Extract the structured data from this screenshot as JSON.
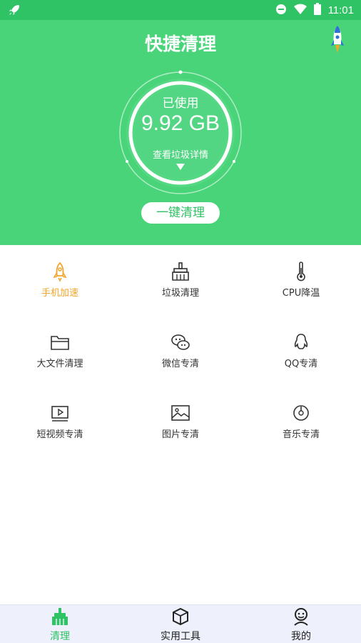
{
  "status_bar": {
    "time": "11:01",
    "icons": [
      "rocket-notification-icon",
      "do-not-disturb-icon",
      "wifi-icon",
      "battery-icon"
    ]
  },
  "header": {
    "title": "快捷清理",
    "rocket_icon": "rocket-icon"
  },
  "storage": {
    "used_label": "已使用",
    "used_value": "9.92 GB",
    "detail_link": "查看垃圾详情"
  },
  "actions": {
    "clean_button": "一键清理"
  },
  "tools": [
    {
      "label": "手机加速",
      "icon": "rocket-icon",
      "active": true
    },
    {
      "label": "垃圾清理",
      "icon": "broom-icon",
      "active": false
    },
    {
      "label": "CPU降温",
      "icon": "thermometer-icon",
      "active": false
    },
    {
      "label": "大文件清理",
      "icon": "folder-icon",
      "active": false
    },
    {
      "label": "微信专清",
      "icon": "wechat-icon",
      "active": false
    },
    {
      "label": "QQ专清",
      "icon": "qq-icon",
      "active": false
    },
    {
      "label": "短视频专清",
      "icon": "video-icon",
      "active": false
    },
    {
      "label": "图片专清",
      "icon": "image-icon",
      "active": false
    },
    {
      "label": "音乐专清",
      "icon": "music-disc-icon",
      "active": false
    }
  ],
  "bottom_nav": [
    {
      "label": "清理",
      "icon": "broom-icon",
      "active": true
    },
    {
      "label": "实用工具",
      "icon": "cube-icon",
      "active": false
    },
    {
      "label": "我的",
      "icon": "profile-icon",
      "active": false
    }
  ],
  "colors": {
    "primary_green": "#49d47a",
    "status_green": "#2fc365",
    "active_orange": "#f3a52a",
    "nav_bg": "#eef1fb"
  }
}
